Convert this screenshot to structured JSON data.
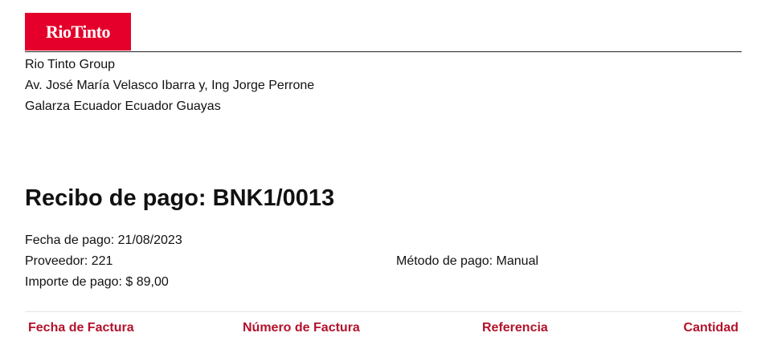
{
  "logo": {
    "text": "RioTinto",
    "background": "#e4002b"
  },
  "company": {
    "name": "Rio Tinto Group",
    "address_line1": "Av. José María Velasco Ibarra y, Ing Jorge Perrone",
    "address_line2": "Galarza Ecuador Ecuador Guayas"
  },
  "receipt": {
    "title": "Recibo de pago: BNK1/0013",
    "payment_date": "Fecha de pago: 21/08/2023",
    "supplier": "Proveedor: 221",
    "payment_method": "Método de pago: Manual",
    "amount": "Importe de pago: $ 89,00"
  },
  "table": {
    "accent_color": "#b3122b",
    "columns": [
      "Fecha de Factura",
      "Número de Factura",
      "Referencia",
      "Cantidad"
    ]
  }
}
